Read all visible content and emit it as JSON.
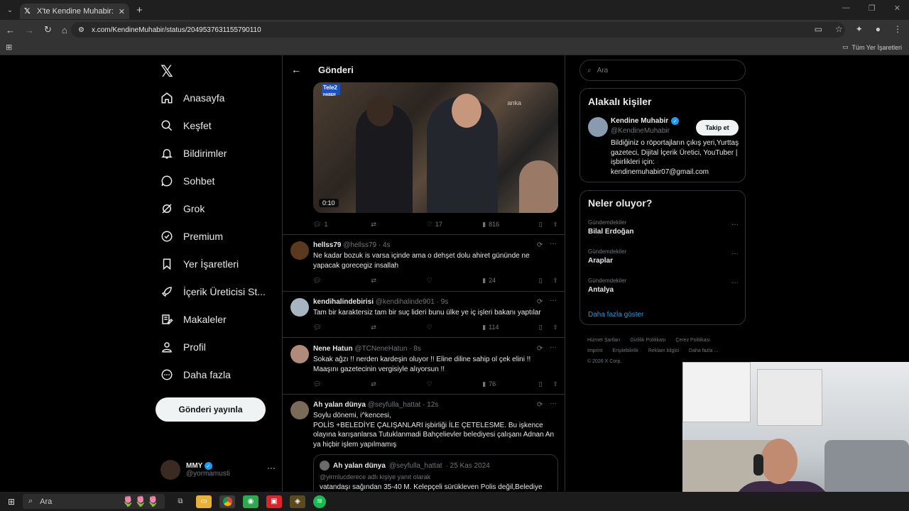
{
  "browser": {
    "tab_title": "X'te Kendine Muhabir: \"Gülista",
    "url": "x.com/KendineMuhabir/status/2049537631155790110",
    "bookmarks_label": "Tüm Yer İşaretleri"
  },
  "nav": {
    "items": [
      {
        "label": "Anasayfa",
        "icon": "home-icon"
      },
      {
        "label": "Keşfet",
        "icon": "search-icon"
      },
      {
        "label": "Bildirimler",
        "icon": "bell-icon"
      },
      {
        "label": "Sohbet",
        "icon": "chat-icon"
      },
      {
        "label": "Grok",
        "icon": "grok-icon"
      },
      {
        "label": "Premium",
        "icon": "premium-icon"
      },
      {
        "label": "Yer İşaretleri",
        "icon": "bookmark-icon"
      },
      {
        "label": "İçerik Üreticisi St...",
        "icon": "rocket-icon"
      },
      {
        "label": "Makaleler",
        "icon": "article-icon"
      },
      {
        "label": "Profil",
        "icon": "profile-icon"
      },
      {
        "label": "Daha fazla",
        "icon": "more-icon"
      }
    ],
    "post_button": "Gönderi yayınla",
    "account": {
      "name": "MMY",
      "handle": "@yormamusti"
    }
  },
  "main": {
    "header_title": "Gönderi",
    "video": {
      "channel": "Tele2",
      "channel_sub": "HABER",
      "watermark": "anka",
      "duration": "0:10"
    },
    "main_actions": {
      "replies": "1",
      "reposts": "",
      "likes": "17",
      "views": "816"
    },
    "replies": [
      {
        "name": "hellss79",
        "handle": "@hellss79",
        "time": "· 4s",
        "text": "Ne kadar bozuk is varsa içinde ama o dehşet dolu ahiret gününde ne yapacak gorecegiz insallah",
        "replies": "",
        "reposts": "",
        "likes": "",
        "views": "24"
      },
      {
        "name": "kendihalindebirisi",
        "handle": "@kendihalinde901",
        "time": "· 9s",
        "text": "Tam bir karaktersiz tam bir suç lideri bunu ülke ye iç işleri bakanı yaptılar",
        "replies": "",
        "reposts": "",
        "likes": "",
        "views": "114"
      },
      {
        "name": "Nene Hatun",
        "handle": "@TCNeneHatun",
        "time": "· 8s",
        "text": "Sokak ağzı !! nerden kardeşin oluyor !! Eline diline sahip ol çek elini !! Maaşını gazetecinin vergisiyle alıyorsun !!",
        "replies": "",
        "reposts": "",
        "likes": "",
        "views": "76"
      },
      {
        "name": "Ah yalan dünya",
        "handle": "@seyfulla_hattat",
        "time": "· 12s",
        "text": "Soylu dönemi, i^kencesi,\nPOLİS +BELEDİYE ÇALIŞANLARI işbirliği İLE ÇETELESME. Bu işkence olayına karışanlarsa Tutuklanmadi Bahçelievler belediyesi çalışanı Adnan An ya hiçbir işlem yapılmamış"
      }
    ],
    "quote": {
      "name": "Ah yalan dünya",
      "handle": "@seyfulla_hattat",
      "date": "· 25 Kas 2024",
      "sub": "@yirmlucderece adlı kişiye yanıt olarak",
      "text": "vatandaşı sağından 35-40 M. Kelepçeli sürükleven Polis değil,Belediye"
    }
  },
  "sidebar": {
    "search_placeholder": "Ara",
    "related_title": "Alakalı kişiler",
    "related": {
      "name": "Kendine Muhabir",
      "handle": "@KendineMuhabir",
      "follow_label": "Takip et",
      "bio": "Bildiğiniz o röportajların çıkış yeri,Yurttaş gazeteci, Dijital İçerik Üretici, YouTuber | işbirlikleri için: kendinemuhabir07@gmail.com"
    },
    "trends_title": "Neler oluyor?",
    "trends": [
      {
        "category": "Gündemdekiler",
        "topic": "Bilal Erdoğan"
      },
      {
        "category": "Gündemdekiler",
        "topic": "Araplar"
      },
      {
        "category": "Gündemdekiler",
        "topic": "Antalya"
      }
    ],
    "show_more": "Daha fazla göster",
    "footer": [
      "Hizmet Şartları",
      "Gizlilik Politikası",
      "Çerez Politikası",
      "Imprint",
      "Erişilebilirlik",
      "Reklam bilgisi",
      "Daha fazla ...",
      "© 2026 X Corp."
    ]
  },
  "taskbar": {
    "search_label": "Ara"
  },
  "colors": {
    "accent": "#1d9bf0",
    "background": "#000000",
    "border": "#2f3336",
    "muted": "#71767b"
  }
}
